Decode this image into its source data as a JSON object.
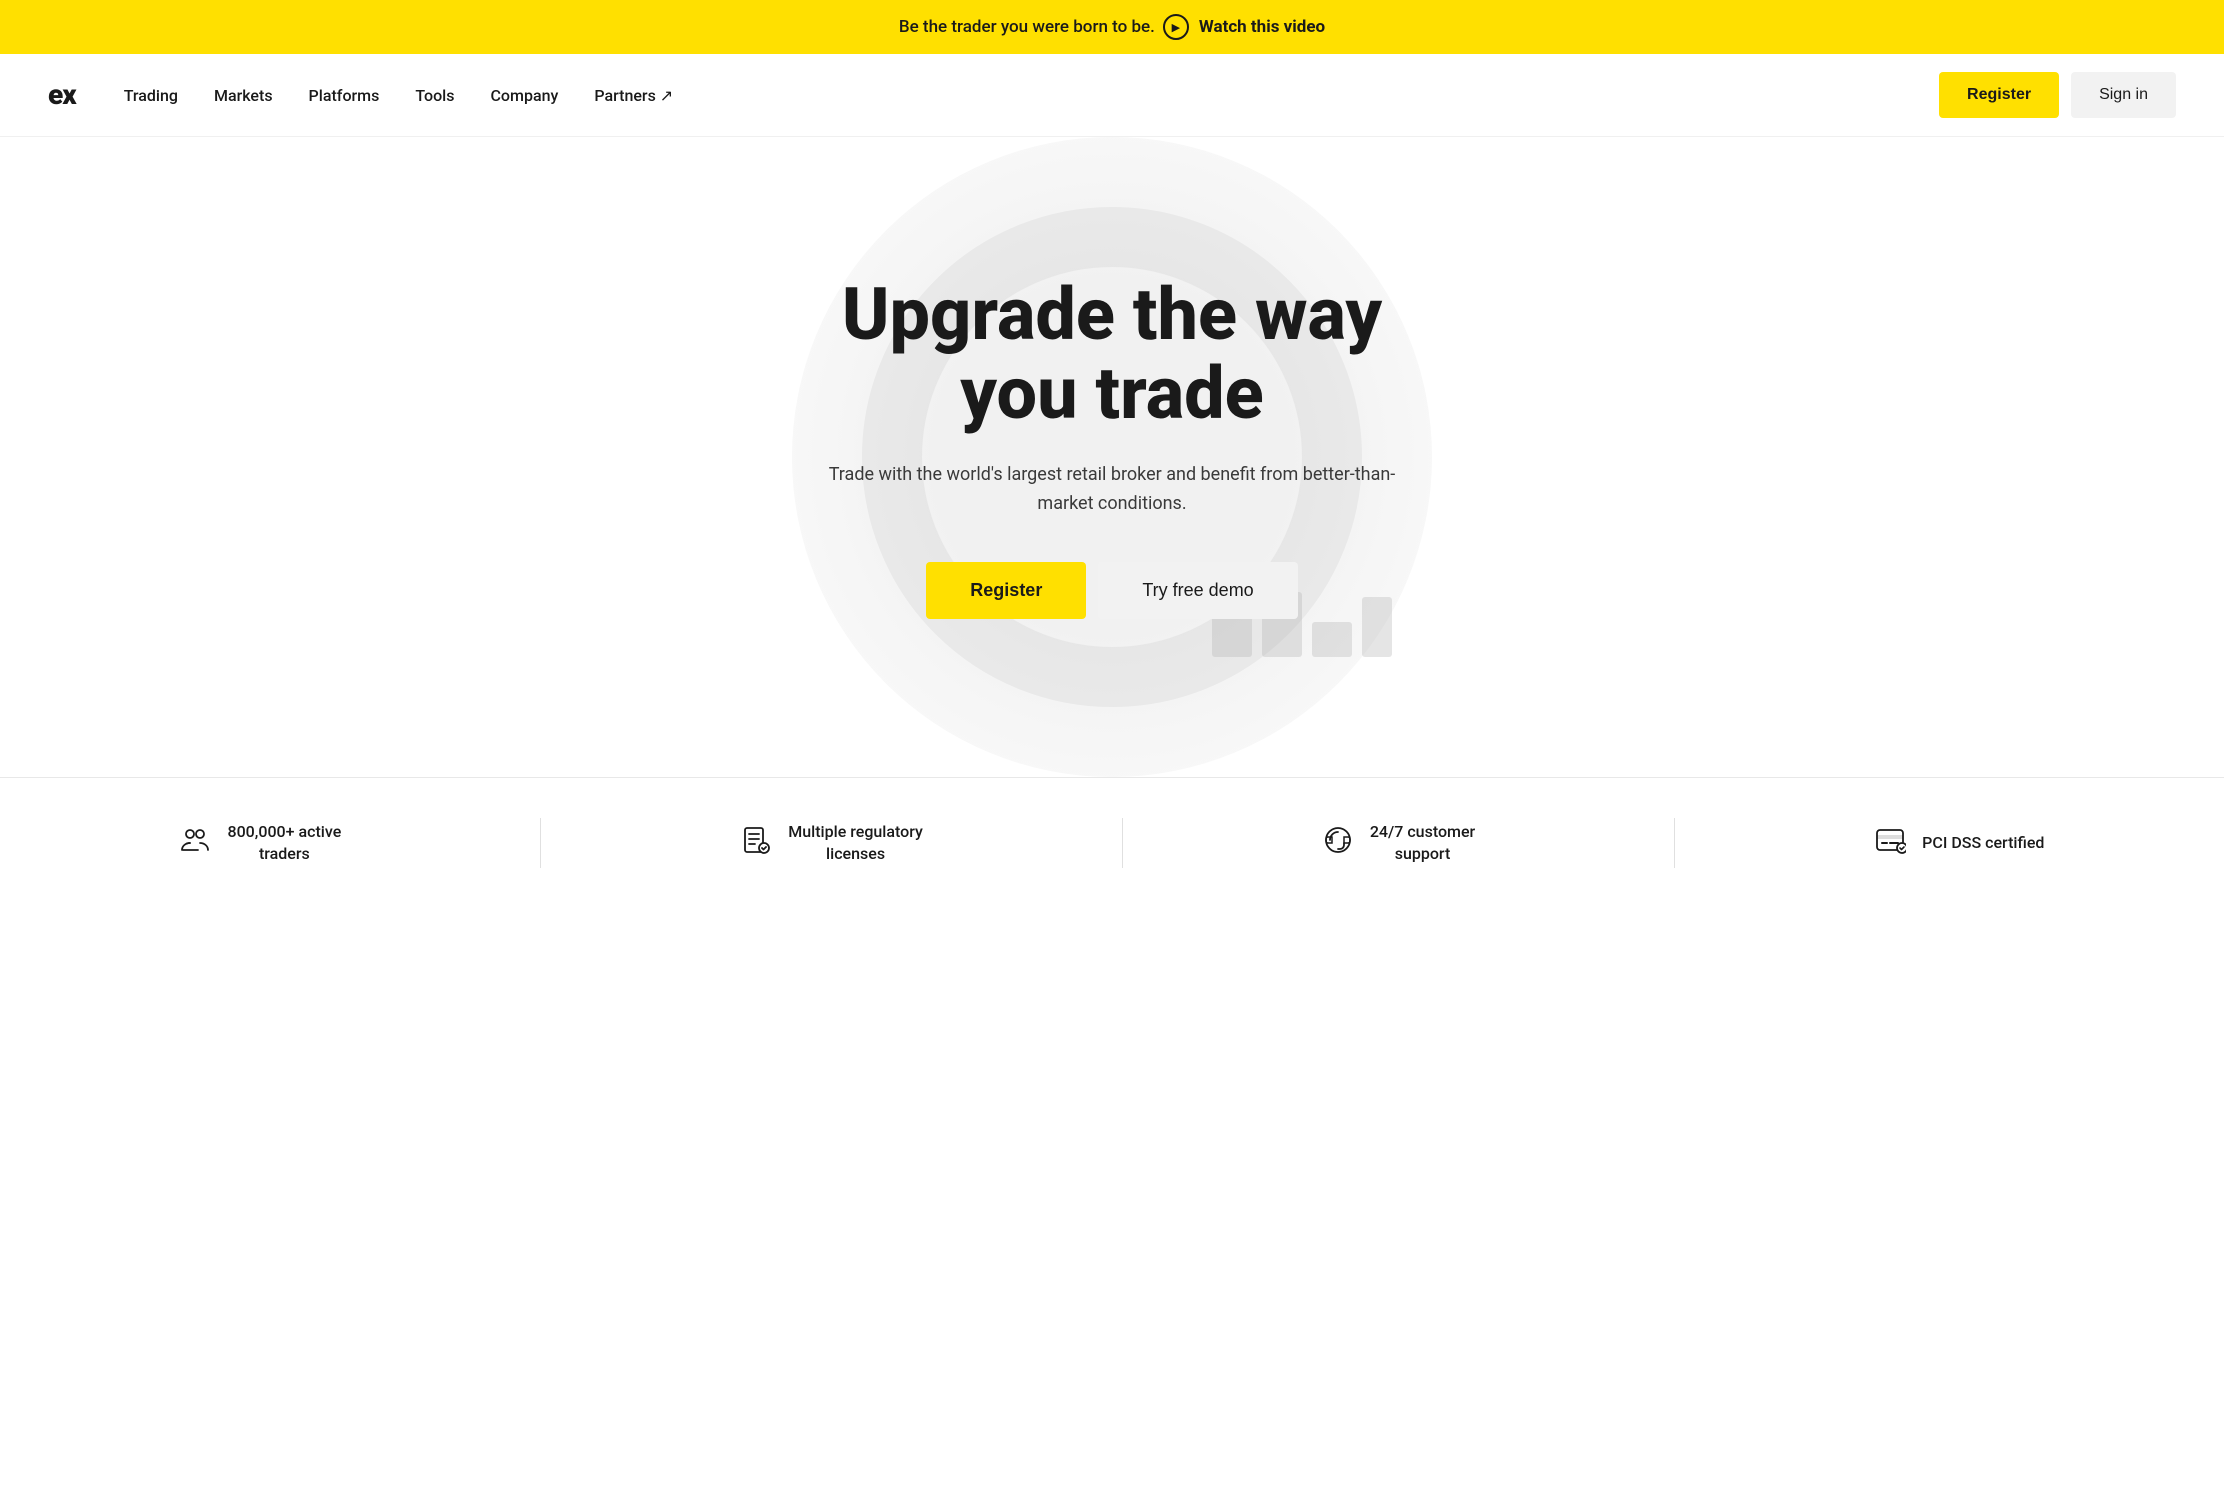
{
  "banner": {
    "text": "Be the trader you were born to be.",
    "link_label": "Watch this video",
    "play_icon": "▶"
  },
  "navbar": {
    "logo": "ex",
    "links": [
      {
        "label": "Trading",
        "has_arrow": false
      },
      {
        "label": "Markets",
        "has_arrow": false
      },
      {
        "label": "Platforms",
        "has_arrow": false
      },
      {
        "label": "Tools",
        "has_arrow": false
      },
      {
        "label": "Company",
        "has_arrow": false
      },
      {
        "label": "Partners ↗",
        "has_arrow": true
      }
    ],
    "register_label": "Register",
    "signin_label": "Sign in"
  },
  "hero": {
    "title_line1": "Upgrade the way",
    "title_line2": "you trade",
    "subtitle": "Trade with the world's largest retail broker and benefit from better-than-market conditions.",
    "register_label": "Register",
    "demo_label": "Try free demo"
  },
  "stats": [
    {
      "icon": "users",
      "text": "800,000+ active\ntraders"
    },
    {
      "icon": "license",
      "text": "Multiple regulatory\nlicenses"
    },
    {
      "icon": "support",
      "text": "24/7 customer\nsupport"
    },
    {
      "icon": "pci",
      "text": "PCI DSS certified"
    }
  ],
  "colors": {
    "yellow": "#FFE000",
    "dark": "#1a1a1a",
    "light_bg": "#f2f2f2"
  }
}
